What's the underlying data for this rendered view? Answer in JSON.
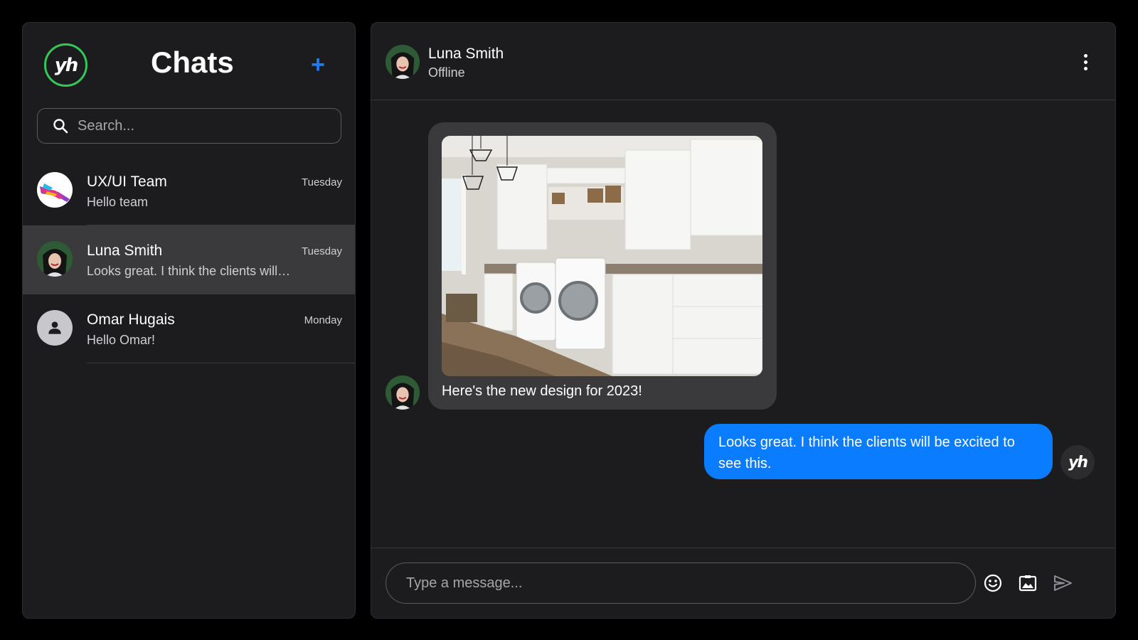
{
  "sidebar": {
    "logo_text": "yh",
    "title": "Chats",
    "new_chat_icon": "plus-icon",
    "search": {
      "placeholder": "Search..."
    },
    "chats": [
      {
        "name": "UX/UI Team",
        "preview": "Hello team",
        "date": "Tuesday",
        "active": false
      },
      {
        "name": "Luna Smith",
        "preview": "Looks great. I think the clients will be excited to see this.",
        "date": "Tuesday",
        "active": true
      },
      {
        "name": "Omar Hugais",
        "preview": "Hello Omar!",
        "date": "Monday",
        "active": false
      }
    ]
  },
  "conversation": {
    "contact_name": "Luna Smith",
    "contact_status": "Offline",
    "messages": [
      {
        "direction": "incoming",
        "has_image": true,
        "image_subject": "laundry room with white cabinets and two washing machines",
        "text": "Here's the new design for 2023!"
      },
      {
        "direction": "outgoing",
        "text": "Looks great. I think the clients will be excited to see this."
      }
    ],
    "composer": {
      "placeholder": "Type a message...",
      "icons": [
        "emoji-icon",
        "image-icon",
        "send-icon"
      ]
    }
  },
  "colors": {
    "background": "#000000",
    "panel": "#1c1c1e",
    "active_item": "#3a3a3c",
    "incoming_bubble": "#3a3a3c",
    "outgoing_bubble": "#0a7cff",
    "accent": "#1e7bf2",
    "logo_ring": "#34c759"
  }
}
